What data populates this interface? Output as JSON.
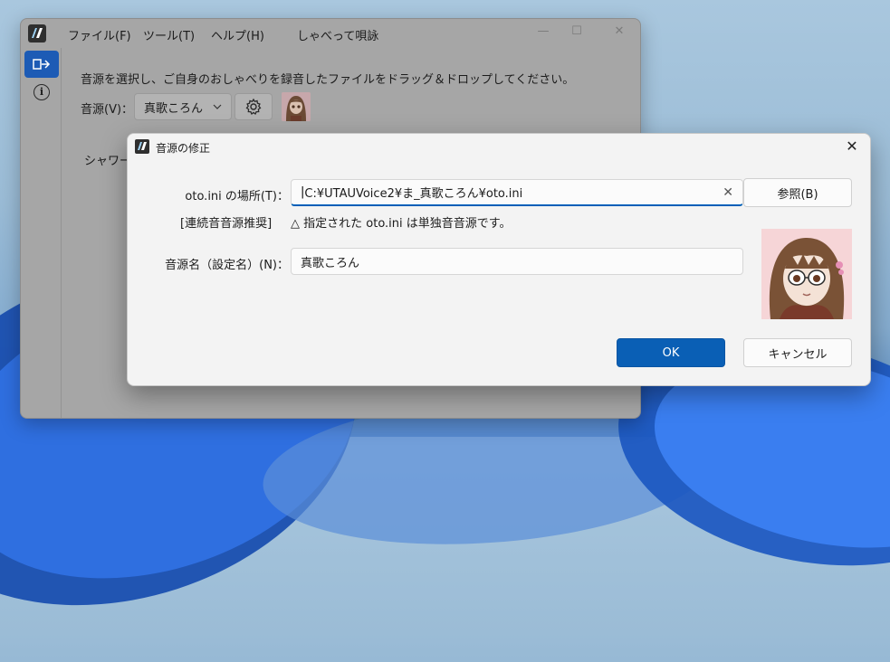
{
  "colors": {
    "accent": "#0a5fb5",
    "sidebar_active": "#1d5bb5",
    "dialog_bg": "#f3f3f3"
  },
  "main_window": {
    "menu": [
      "ファイル(F)",
      "ツール(T)",
      "ヘルプ(H)",
      "しゃべって唄詠"
    ],
    "window_controls": [
      "minimize-icon",
      "maximize-icon",
      "close-icon"
    ],
    "sidebar": [
      {
        "icon": "switch-icon",
        "active": true
      },
      {
        "icon": "info-icon",
        "active": false
      }
    ],
    "instruction": "音源を選択し、ご自身のおしゃべりを録音したファイルをドラッグ＆ドロップしてください。",
    "voice_label": "音源(V)：",
    "voice_selected": "真歌ころん",
    "partial_text": "シャワーで"
  },
  "dialog": {
    "title": "音源の修正",
    "oto_label": "oto.ini の場所(T)：",
    "oto_value": "C:¥UTAUVoice2¥ま_真歌ころん¥oto.ini",
    "browse_label": "参照(B)",
    "status_tag": "[連続音音源推奨]",
    "status_text": "△ 指定された oto.ini は単独音音源です。",
    "name_label": "音源名（設定名）(N)：",
    "name_value": "真歌ころん",
    "ok_label": "OK",
    "cancel_label": "キャンセル"
  }
}
